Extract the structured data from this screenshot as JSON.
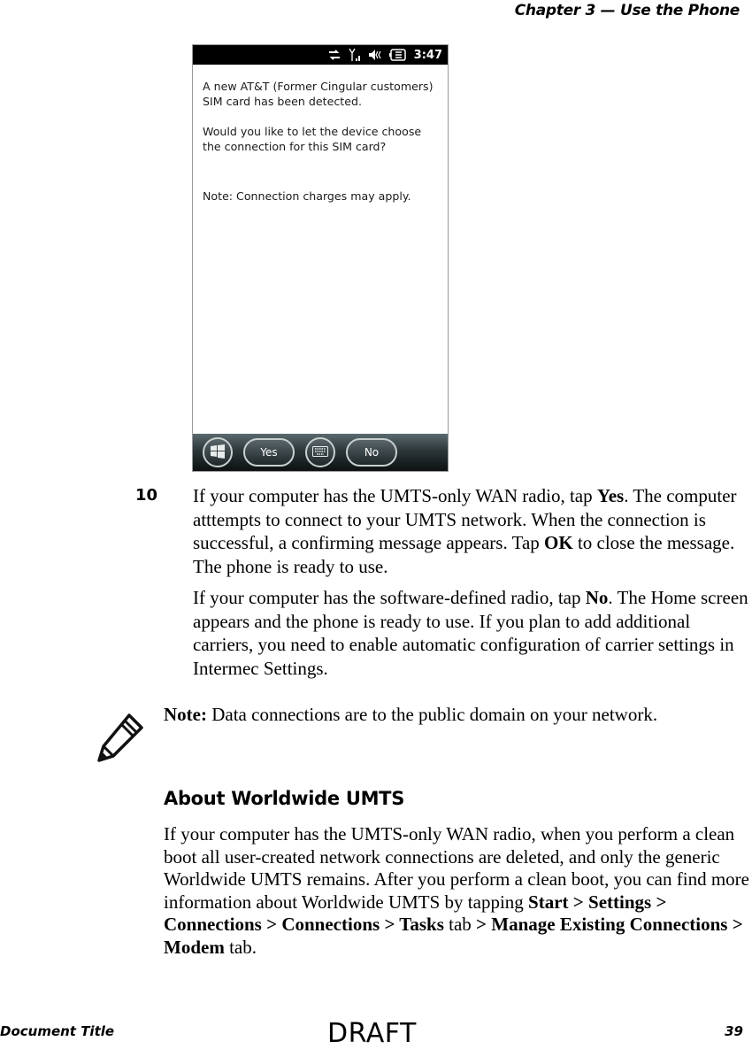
{
  "header": {
    "chapter_title": "Chapter 3 — Use the Phone"
  },
  "phone_screen": {
    "status_bar": {
      "icons": [
        "data-sync-icon",
        "signal-strength-icon",
        "speaker-muted-icon",
        "battery-charging-icon"
      ],
      "time": "3:47"
    },
    "message": {
      "line1": "A new AT&T (Former Cingular customers) SIM card has been detected.",
      "line2": "Would you like to let the device choose the connection for this SIM card?",
      "line3": "Note: Connection charges may apply."
    },
    "nav_bar": {
      "start_icon": "windows-start-icon",
      "yes_label": "Yes",
      "keyboard_icon": "keyboard-icon",
      "no_label": "No"
    }
  },
  "step": {
    "number": "10",
    "para1": {
      "t1": "If your computer has the UMTS-only WAN radio, tap ",
      "b1": "Yes",
      "t2": ". The computer atttempts to connect to your UMTS network. When the connection is successful, a confirming message appears. Tap ",
      "b2": "OK",
      "t3": " to close the message. The phone is ready to use."
    },
    "para2": {
      "t1": "If your computer has the software-defined radio, tap ",
      "b1": "No",
      "t2": ". The Home screen appears and the phone is ready to use. If you plan to add additional carriers, you need to enable automatic configuration of carrier settings in Intermec Settings."
    }
  },
  "note": {
    "icon": "pencil-note-icon",
    "label": "Note:",
    "text": " Data connections are to the public domain on your network."
  },
  "section": {
    "heading": "About Worldwide UMTS",
    "body": "If your computer has the UMTS-only WAN radio, when you perform a clean boot all user-created network connections are deleted, and only the generic Worldwide UMTS remains. After you perform a clean boot, you can find more information about Worldwide UMTS by tapping ",
    "path": {
      "start": "Start",
      "sep": " > ",
      "settings": "Settings",
      "connections1": "Connections",
      "connections2": "Connections",
      "tasks": "Tasks",
      "tab1": " tab ",
      "manage": "Manage Existing Connections",
      "modem": "Modem",
      "tab2": " tab."
    }
  },
  "footer": {
    "document_title": "Document Title",
    "watermark": "DRAFT",
    "page_number": "39"
  }
}
